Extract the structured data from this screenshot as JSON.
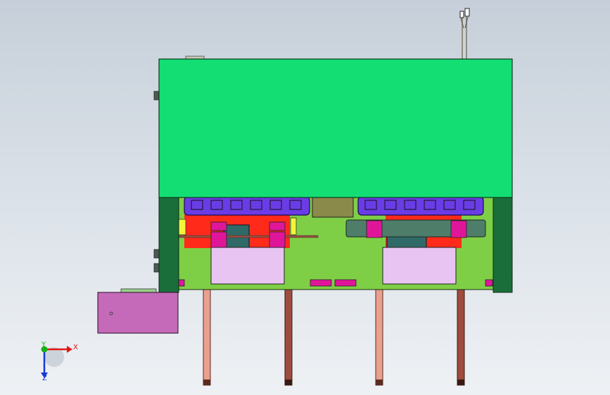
{
  "viewport": {
    "background_top": "#c6cfd9",
    "background_bottom": "#eef1f4"
  },
  "colors": {
    "cover_green": "#13de74",
    "dark_green": "#1a6e3a",
    "pcb_green": "#7fcf46",
    "bus_bar_blue": "#6a3ce6",
    "cavity_pink": "#e8c4f2",
    "clamp_magenta": "#e0169a",
    "side_box_magenta": "#c46ab8",
    "leg_salmon": "#e9a08e",
    "leg_brown": "#9e4c3e",
    "rail_teal": "#4e7d6a",
    "red_zone": "#ff2a1a",
    "yellow_part": "#f4f43a",
    "olive_block": "#8a8a4a"
  },
  "triad": {
    "x_label": "X",
    "y_label": "Y",
    "z_label": "Z",
    "x_color": "#e01818",
    "y_color": "#18b018",
    "z_color": "#1838d8"
  }
}
